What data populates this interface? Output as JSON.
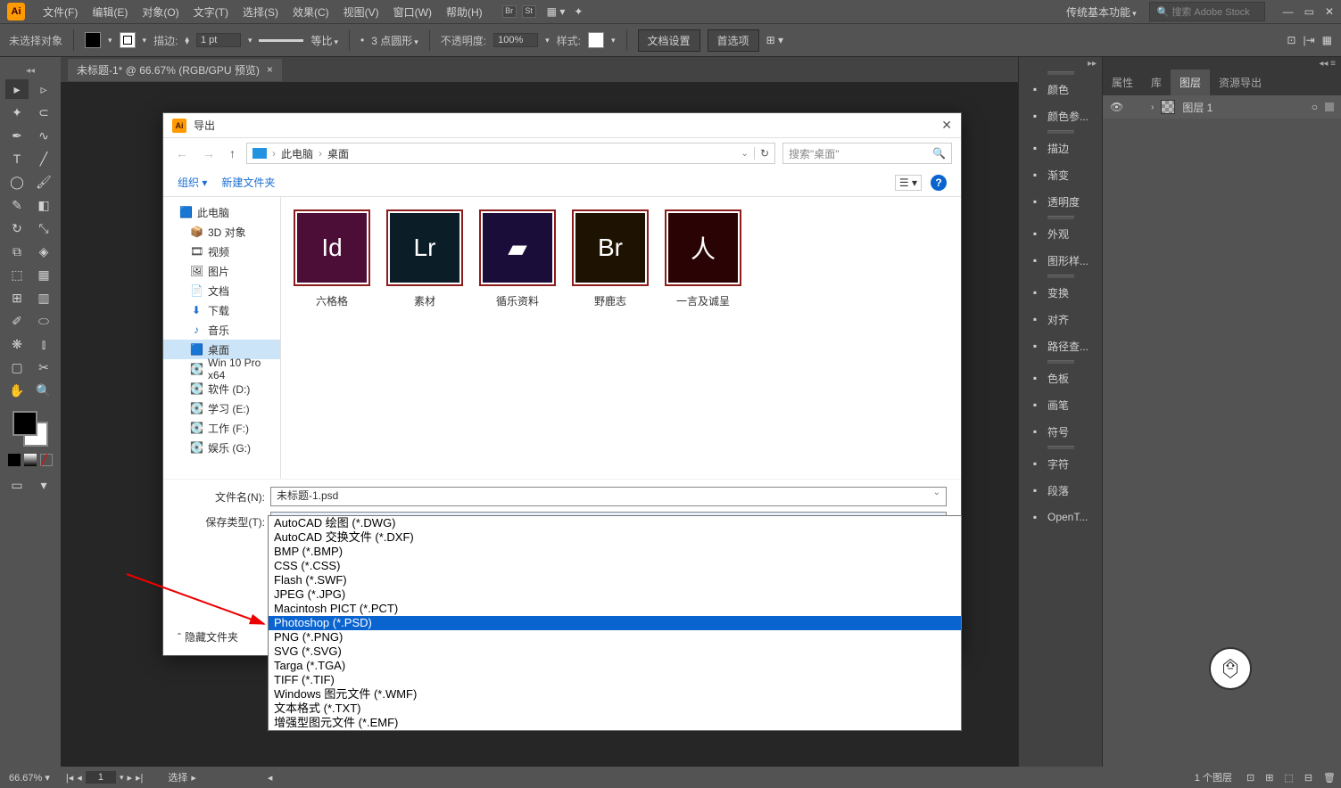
{
  "menubar": {
    "items": [
      "文件(F)",
      "编辑(E)",
      "对象(O)",
      "文字(T)",
      "选择(S)",
      "效果(C)",
      "视图(V)",
      "窗口(W)",
      "帮助(H)"
    ],
    "workspace": "传统基本功能",
    "search_placeholder": "搜索 Adobe Stock"
  },
  "optionsbar": {
    "no_selection": "未选择对象",
    "stroke_label": "描边:",
    "stroke_value": "1 pt",
    "uniform": "等比",
    "dot_style": "3 点圆形",
    "opacity_label": "不透明度:",
    "opacity_value": "100%",
    "style_label": "样式:",
    "doc_setup": "文档设置",
    "prefs": "首选项"
  },
  "doc_tab": "未标题-1* @ 66.67% (RGB/GPU 预览)",
  "panelstrip": [
    "颜色",
    "颜色参...",
    "描边",
    "渐变",
    "透明度",
    "外观",
    "图形样...",
    "变换",
    "对齐",
    "路径查...",
    "色板",
    "画笔",
    "符号",
    "字符",
    "段落",
    "OpenT..."
  ],
  "layers_panel": {
    "tabs": [
      "属性",
      "库",
      "图层",
      "资源导出"
    ],
    "active_tab": 2,
    "layer_name": "图层 1"
  },
  "statusbar": {
    "zoom": "66.67%",
    "page": "1",
    "tool": "选择",
    "right": "1 个图层"
  },
  "dialog": {
    "title": "导出",
    "path_parts": [
      "此电脑",
      "桌面"
    ],
    "search_placeholder": "搜索\"桌面\"",
    "organize": "组织",
    "new_folder": "新建文件夹",
    "tree": [
      {
        "icon": "🟦",
        "label": "此电脑",
        "sel": false,
        "indent": 0,
        "iconClass": "ps"
      },
      {
        "icon": "📦",
        "label": "3D 对象",
        "sel": false,
        "indent": 1
      },
      {
        "icon": "🎞",
        "label": "视频",
        "sel": false,
        "indent": 1
      },
      {
        "icon": "🖼",
        "label": "图片",
        "sel": false,
        "indent": 1
      },
      {
        "icon": "📄",
        "label": "文档",
        "sel": false,
        "indent": 1
      },
      {
        "icon": "⬇",
        "label": "下载",
        "sel": false,
        "indent": 1,
        "color": "#1a6fd4"
      },
      {
        "icon": "♪",
        "label": "音乐",
        "sel": false,
        "indent": 1,
        "color": "#1a6fd4"
      },
      {
        "icon": "🟦",
        "label": "桌面",
        "sel": true,
        "indent": 1
      },
      {
        "icon": "💽",
        "label": "Win 10 Pro x64",
        "sel": false,
        "indent": 1
      },
      {
        "icon": "💽",
        "label": "软件 (D:)",
        "sel": false,
        "indent": 1
      },
      {
        "icon": "💽",
        "label": "学习 (E:)",
        "sel": false,
        "indent": 1
      },
      {
        "icon": "💽",
        "label": "工作 (F:)",
        "sel": false,
        "indent": 1
      },
      {
        "icon": "💽",
        "label": "娱乐 (G:)",
        "sel": false,
        "indent": 1
      }
    ],
    "files": [
      {
        "name": "六格格",
        "bg": "#4c0e36",
        "text": "Id"
      },
      {
        "name": "素材",
        "bg": "#0b1e28",
        "text": "Lr"
      },
      {
        "name": "循乐资料",
        "bg": "#1a0d3a",
        "text": "▰"
      },
      {
        "name": "野鹿志",
        "bg": "#1e1303",
        "text": "Br"
      },
      {
        "name": "一言及诚呈",
        "bg": "#2a0404",
        "text": "人"
      }
    ],
    "filename_label": "文件名(N):",
    "filename_value": "未标题-1.psd",
    "filetype_label": "保存类型(T):",
    "filetype_value": "Photoshop (*.PSD)",
    "hide_folders": "隐藏文件夹",
    "dropdown_options": [
      "AutoCAD 绘图 (*.DWG)",
      "AutoCAD 交换文件 (*.DXF)",
      "BMP (*.BMP)",
      "CSS (*.CSS)",
      "Flash (*.SWF)",
      "JPEG (*.JPG)",
      "Macintosh PICT (*.PCT)",
      "Photoshop (*.PSD)",
      "PNG (*.PNG)",
      "SVG (*.SVG)",
      "Targa (*.TGA)",
      "TIFF (*.TIF)",
      "Windows 图元文件 (*.WMF)",
      "文本格式 (*.TXT)",
      "增强型图元文件 (*.EMF)"
    ],
    "dropdown_selected_index": 7
  }
}
